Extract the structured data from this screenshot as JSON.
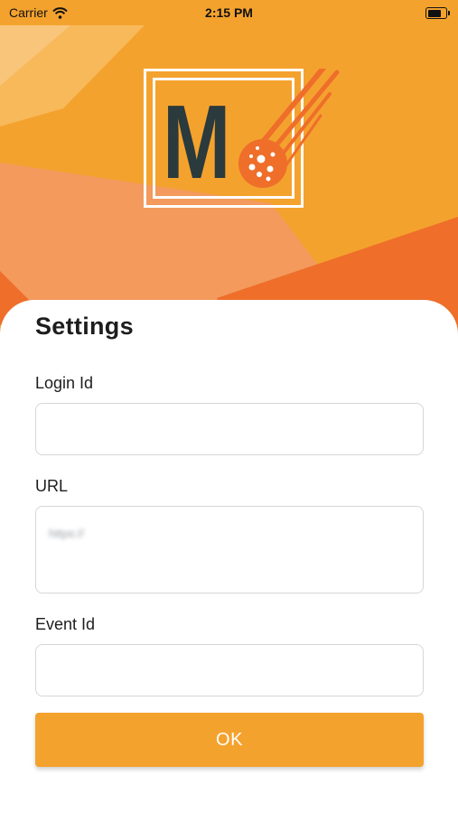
{
  "status_bar": {
    "carrier": "Carrier",
    "time": "2:15 PM",
    "battery_level": 0.9
  },
  "logo": {
    "letter": "M",
    "icon": "comet-icon"
  },
  "settings": {
    "title": "Settings",
    "login_id": {
      "label": "Login Id",
      "value": ""
    },
    "url": {
      "label": "URL",
      "value": "https://"
    },
    "event_id": {
      "label": "Event Id",
      "value": ""
    },
    "ok_label": "OK"
  },
  "colors": {
    "primary": "#f4a22e",
    "accent_dark": "#ee6e2a",
    "text": "#1d1d1d",
    "logo_text": "#2b3a3c"
  }
}
